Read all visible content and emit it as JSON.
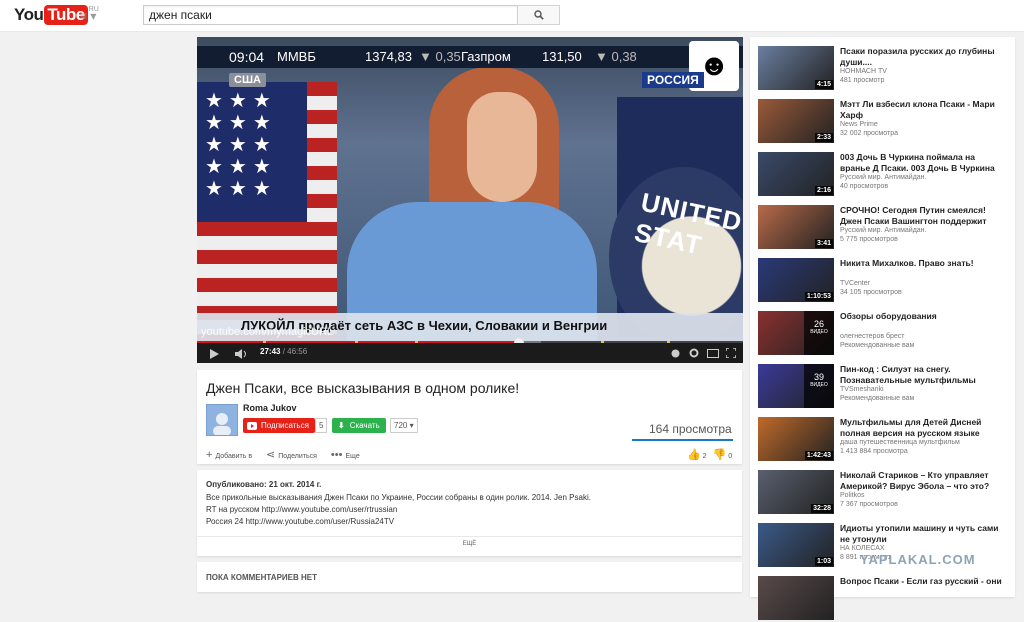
{
  "masthead": {
    "logo_you": "You",
    "logo_tube": "Tube",
    "logo_region": "RU",
    "guide_icon": "≡ ▾",
    "search_value": "джен псаки",
    "search_button_icon": "search-icon"
  },
  "player": {
    "ticker_time": "09:04",
    "ticker_exchange": "ММВБ",
    "ticker_value": "1374,83",
    "ticker_change": "▼ 0,35",
    "ticker_company": "Газпром",
    "ticker_company_value": "131,50",
    "ticker_company_change": "▼ 0,38",
    "channel_badge": "РОССИЯ",
    "country_badge": "США",
    "seal_text": "UNITED STAT",
    "lower_third": "ЛУКОЙЛ продаёт сеть АЗС в Чехии, Словакии и Венгрии",
    "watermark": "youtube.com/mymagicURL",
    "current_time": "27:43",
    "duration": "/ 46:56",
    "progress_fraction": 0.59,
    "loaded_fraction": 0.63,
    "marker_fractions": [
      0.12,
      0.29,
      0.4,
      0.74,
      0.86
    ],
    "accent_color": "#cc181e"
  },
  "video": {
    "title": "Джен Псаки, все высказывания в одном ролике!",
    "channel": "Roma Jukov",
    "subscribe_label": "Подписаться",
    "subscribe_count": "5",
    "download_label": "Скачать",
    "download_quality": "720 ▾",
    "views": "164 просмотра",
    "add_to": "Добавить в",
    "share": "Поделиться",
    "more": "Еще",
    "likes": "2",
    "dislikes": "0"
  },
  "description": {
    "published": "Опубликовано: 21 окт. 2014 г.",
    "lines": [
      "Все прикольные высказывания Джен Псаки по Украине, России собраны в один ролик. 2014. Jen Psaki.",
      "RT на русском http://www.youtube.com/user/rtrussian",
      "Россия 24 http://www.youtube.com/user/Russia24TV"
    ],
    "show_more": "ЕЩЁ"
  },
  "comments": {
    "none_label": "ПОКА КОММЕНТАРИЕВ НЕТ"
  },
  "related": [
    {
      "title": "Псаки поразила русских до глубины души....",
      "channel": "НОНМАСН TV",
      "views": "481 просмотр",
      "duration": "4:15",
      "color": "#6b7fa0"
    },
    {
      "title": "Мэтт Ли взбесил клона Псаки - Мари Харф",
      "channel": "News Prime",
      "views": "32 002 просмотра",
      "duration": "2:33",
      "color": "#9a5a3a"
    },
    {
      "title": "003 Дочь В Чуркина поймала на вранье Д Псаки. 003 Дочь В Чуркина",
      "channel": "Русский мир. Антимайдан.",
      "views": "40 просмотров",
      "duration": "2:16",
      "color": "#3a4a6a"
    },
    {
      "title": "СРОЧНО! Сегодня Путин смеялся! Джен Псаки Вашингтон поддержит",
      "channel": "Русский мир. Антимайдан.",
      "views": "5 775 просмотров",
      "duration": "3:41",
      "color": "#b86a4a"
    },
    {
      "title": "Никита Михалков. Право знать!",
      "channel": "TVCenter",
      "views": "34 105 просмотров",
      "duration": "1:10:53",
      "color": "#2a3a7a"
    },
    {
      "title": "Обзоры оборудования",
      "channel": "олегнестеров брест",
      "views": "Рекомендованные вам",
      "duration": "",
      "playlist_count": "26",
      "playlist_label": "ВИДЕО",
      "color": "#8a3030"
    },
    {
      "title": "Пин-код : Силуэт на снегу. Познавательные мультфильмы",
      "channel": "TVSmeshariki",
      "views": "Рекомендованные вам",
      "duration": "",
      "playlist_count": "39",
      "playlist_label": "ВИДЕО",
      "color": "#3a3a9a"
    },
    {
      "title": "Мультфильмы для Детей Дисней полная версия на русском языке",
      "channel": "даша путешественница мультфильм",
      "views": "1 413 884 просмотра",
      "duration": "1:42:43",
      "color": "#c06a2a"
    },
    {
      "title": "Николай Стариков – Кто управляет Америкой? Вирус Эбола – что это?",
      "channel": "Politkos",
      "views": "7 367 просмотров",
      "duration": "32:28",
      "color": "#5a6070"
    },
    {
      "title": "Идиоты утопили машину и чуть сами не утонули",
      "channel": "НА КОЛЕСАХ",
      "views": "8 891 просмотр",
      "duration": "1:03",
      "color": "#3a5a8a"
    },
    {
      "title": "Вопрос Псаки - Если газ русский - они",
      "channel": "",
      "views": "",
      "duration": "",
      "color": "#5a4a4a"
    }
  ],
  "watermark_site": "YAPLAKAL.COM"
}
